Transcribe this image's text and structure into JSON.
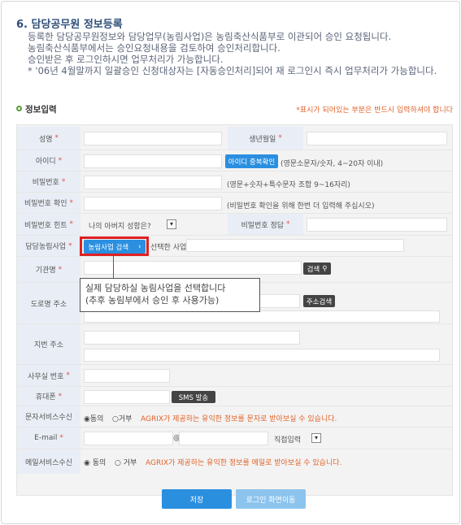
{
  "section_title": "6. 담당공무원 정보등록",
  "intro": [
    "등록한 담당공무원정보와 담당업무(농림사업)은 농림축산식품부로 이관되어 승인 요청됩니다.",
    "농림축산식품부에서는 승인요청내용을 검토하여 승인처리합니다.",
    "승인받은 후 로그인하시면 업무처리가 가능합니다."
  ],
  "intro_note": "* '06년 4월말까지 일괄승인 신청대상자는 [자동승인처리]되어 재 로그인시 즉시 업무처리가 가능합니다.",
  "form_title": "정보입력",
  "required_note": "*표시가 되어있는 부분은 반드시 입력하셔야 합니다",
  "labels": {
    "name": "성명",
    "birth": "생년월일",
    "id": "아이디",
    "password": "비밀번호",
    "password_confirm": "비밀번호 확인",
    "password_hint": "비밀번호 힌트",
    "hint_answer": "비밀번호 정답",
    "project": "담당농림사업",
    "agency": "기관명",
    "road_address": "도로명 주소",
    "lot_address": "지번 주소",
    "office_phone": "사무실 번호",
    "mobile": "휴대폰",
    "sms_service": "문자서비스수신",
    "email": "E-mail",
    "mail_service": "메일서비스수신"
  },
  "star": "*",
  "id_check_button": "아이디 중복확인",
  "id_hint": "(영문소문자/숫자, 4~20자 이내)",
  "password_hint_text": "(영문+숫자+특수문자 조합 9~16자리)",
  "password_confirm_hint": "(비밀번호 확인을 위해 한번 더 입력해 주십시오)",
  "hint_question": "나의 아버지 성함은?",
  "project_search_button": "농림사업 검색",
  "project_selected_label": "선택한 사업 :",
  "search_button": "검색",
  "address_search_button": "주소검색",
  "sms_button": "SMS 발송",
  "agree": "동의",
  "disagree": "거부",
  "sms_notice": "AGRIX가 제공하는 유익한 정보를 문자로 받아보실 수 있습니다.",
  "mail_notice": "AGRIX가 제공하는 유익한 정보를 메일로 받아보실 수 있습니다.",
  "email_at": "@",
  "email_direct": "직접입력",
  "callout": [
    "실제 담당하실 농림사업을 선택합니다",
    "(추후 농림부에서 승인 후 사용가능)"
  ],
  "save_button": "저장",
  "login_button": "로그인 화면이동"
}
